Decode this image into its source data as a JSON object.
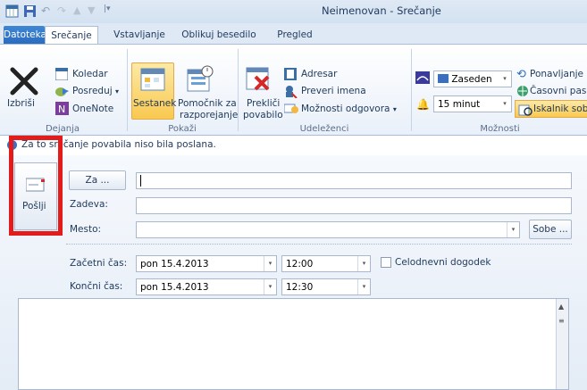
{
  "window": {
    "title": "Neimenovan - Srečanje"
  },
  "tabs": [
    "Datoteka",
    "Srečanje",
    "Vstavljanje",
    "Oblikuj besedilo",
    "Pregled"
  ],
  "ribbon": {
    "actions": {
      "delete": "Izbriši",
      "calendar": "Koledar",
      "forward": "Posreduj",
      "forward_arrow": "▾",
      "onenote": "OneNote",
      "group": "Dejanja"
    },
    "show": {
      "meeting": "Sestanek",
      "assistant_line1": "Pomočnik za",
      "assistant_line2": "razporejanje",
      "group": "Pokaži"
    },
    "attendees": {
      "cancel_line1": "Prekliči",
      "cancel_line2": "povabilo",
      "address_book": "Adresar",
      "check_names": "Preveri imena",
      "response_options": "Možnosti odgovora",
      "response_arrow": "▾",
      "group": "Udeleženci"
    },
    "options": {
      "show_as": "Zaseden",
      "reminder": "15 minut",
      "recurrence": "Ponavljanje",
      "time_zones": "Časovni pasovi",
      "room_finder": "Iskalnik sob",
      "group": "Možnosti"
    }
  },
  "info": {
    "message": "Za to srečanje povabila niso bila poslana."
  },
  "form": {
    "send": "Pošlji",
    "to_button": "Za ...",
    "subject_label": "Zadeva:",
    "location_label": "Mesto:",
    "rooms_button": "Sobe ...",
    "start_label": "Začetni čas:",
    "end_label": "Končni čas:",
    "start_date": "pon 15.4.2013",
    "start_time": "12:00",
    "end_date": "pon 15.4.2013",
    "end_time": "12:30",
    "all_day": "Celodnevni dogodek",
    "to_value": "",
    "subject_value": "",
    "location_value": ""
  },
  "colors": {
    "highlight": "#e31b1b",
    "accent": "#2b6cbf"
  }
}
